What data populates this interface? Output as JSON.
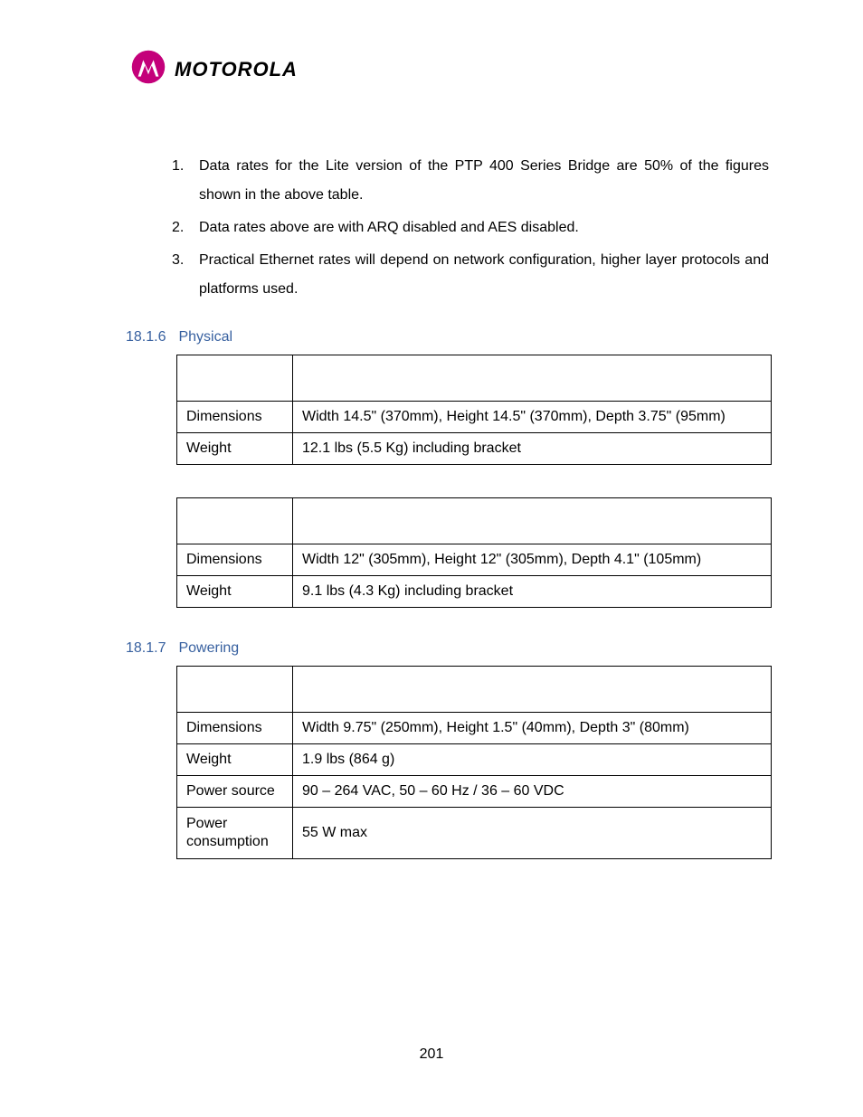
{
  "logo": {
    "wordmark": "MOTOROLA"
  },
  "notes": [
    "Data rates for the Lite version of the PTP 400 Series Bridge are 50% of the figures shown in the above table.",
    "Data rates above are with ARQ disabled and AES disabled.",
    "Practical Ethernet rates will depend on network configuration, higher layer protocols and platforms used."
  ],
  "sections": {
    "physical": {
      "number": "18.1.6",
      "title": "Physical"
    },
    "powering": {
      "number": "18.1.7",
      "title": "Powering"
    }
  },
  "tables": {
    "physical1": {
      "rows": [
        {
          "label": "Dimensions",
          "value": "Width 14.5\" (370mm), Height 14.5\" (370mm), Depth 3.75\" (95mm)"
        },
        {
          "label": "Weight",
          "value": "12.1 lbs (5.5 Kg) including bracket"
        }
      ]
    },
    "physical2": {
      "rows": [
        {
          "label": "Dimensions",
          "value": "Width 12\" (305mm), Height 12\" (305mm), Depth 4.1\" (105mm)"
        },
        {
          "label": "Weight",
          "value": "9.1 lbs (4.3 Kg) including bracket"
        }
      ]
    },
    "powering": {
      "rows": [
        {
          "label": "Dimensions",
          "value": "Width 9.75\" (250mm), Height 1.5\" (40mm), Depth 3\" (80mm)"
        },
        {
          "label": "Weight",
          "value": "1.9 lbs (864 g)"
        },
        {
          "label": "Power source",
          "value": "90 – 264 VAC, 50 – 60 Hz / 36 – 60 VDC"
        },
        {
          "label": "Power consumption",
          "value": "55 W max"
        }
      ]
    }
  },
  "page_number": "201"
}
